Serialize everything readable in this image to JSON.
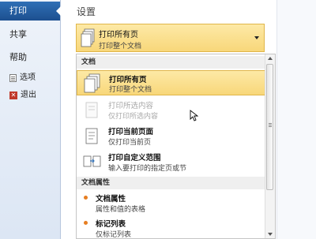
{
  "nav": {
    "print": "打印",
    "share": "共享",
    "help": "帮助",
    "options": "选项",
    "exit": "退出"
  },
  "settings": {
    "title": "设置",
    "selected": {
      "title": "打印所有页",
      "subtitle": "打印整个文档"
    }
  },
  "dropdown": {
    "group_document": "文档",
    "group_properties": "文档属性",
    "items": [
      {
        "title": "打印所有页",
        "subtitle": "打印整个文档",
        "state": "selected"
      },
      {
        "title": "打印所选内容",
        "subtitle": "仅打印所选内容",
        "state": "disabled"
      },
      {
        "title": "打印当前页面",
        "subtitle": "仅打印当前页",
        "state": "normal"
      },
      {
        "title": "打印自定义范围",
        "subtitle": "输入要打印的指定页或节",
        "state": "normal"
      }
    ],
    "properties": [
      {
        "title": "文档属性",
        "subtitle": "属性和值的表格"
      },
      {
        "title": "标记列表",
        "subtitle": "仅标记列表"
      }
    ]
  },
  "colors": {
    "nav_selected": "#1c4f8f",
    "highlight": "#f8d77a",
    "highlight_border": "#e0b64a",
    "bullet": "#e67e22"
  }
}
